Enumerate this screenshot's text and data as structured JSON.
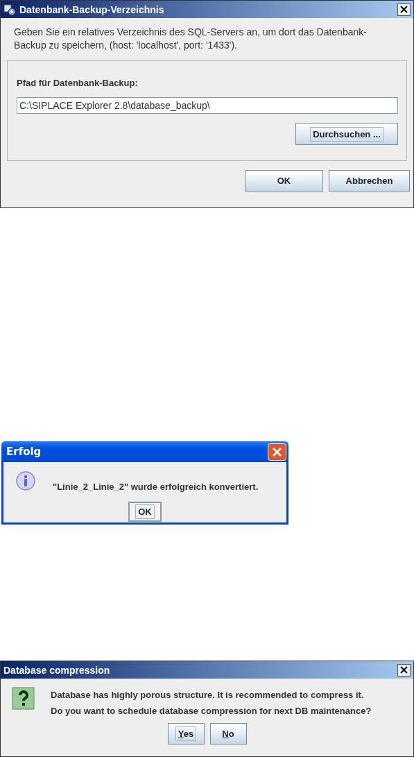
{
  "dialogs": [
    {
      "kind": "form",
      "title": "Datenbank-Backup-Verzeichnis",
      "message": "Geben Sie ein relatives Verzeichnis des SQL-Servers an, um dort das Datenbank-Backup zu speichern, (host: 'localhost', port: '1433').",
      "field_label": "Pfad für Datenbank-Backup:",
      "field_value": "C:\\SIPLACE Explorer 2.8\\database_backup\\",
      "browse": {
        "label": "Durchsuchen ...",
        "focused": true
      },
      "buttons": [
        {
          "label": "OK",
          "focused": false,
          "underline_first": false
        },
        {
          "label": "Abbrechen",
          "focused": false,
          "underline_first": false
        }
      ]
    },
    {
      "kind": "xp",
      "title": "Erfolg",
      "lines": [
        "\"Linie_2_Linie_2\" wurde erfolgreich konvertiert."
      ],
      "buttons": [
        {
          "label": "OK",
          "focused": true,
          "underline_first": false
        }
      ]
    },
    {
      "kind": "metal",
      "title": "Database compression",
      "lines": [
        "Database has highly porous structure. It is recommended to compress it.",
        "Do you want to schedule database compression for next DB maintenance?"
      ],
      "buttons": [
        {
          "label": "Yes",
          "focused": true,
          "underline_first": true
        },
        {
          "label": "No",
          "focused": false,
          "underline_first": true
        }
      ]
    }
  ]
}
